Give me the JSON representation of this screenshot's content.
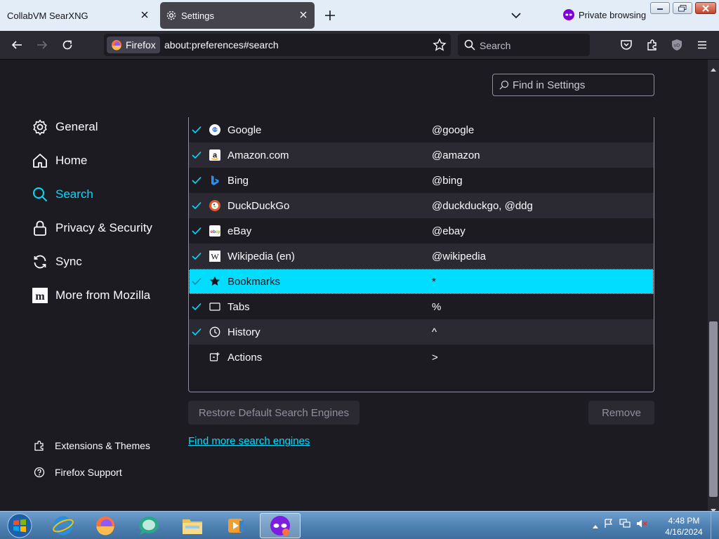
{
  "tabs": [
    {
      "title": "CollabVM SearXNG"
    },
    {
      "title": "Settings"
    }
  ],
  "private_label": "Private browsing",
  "urlbar": {
    "identity": "Firefox",
    "url": "about:preferences#search"
  },
  "searchbar": {
    "placeholder": "Search"
  },
  "find_settings_placeholder": "Find in Settings",
  "categories": [
    {
      "label": "General",
      "icon": "gear-icon"
    },
    {
      "label": "Home",
      "icon": "home-icon"
    },
    {
      "label": "Search",
      "icon": "search-icon",
      "selected": true
    },
    {
      "label": "Privacy & Security",
      "icon": "lock-icon"
    },
    {
      "label": "Sync",
      "icon": "sync-icon"
    },
    {
      "label": "More from Mozilla",
      "icon": "mozilla-icon"
    }
  ],
  "footer_links": [
    {
      "label": "Extensions & Themes",
      "icon": "puzzle-icon"
    },
    {
      "label": "Firefox Support",
      "icon": "help-icon"
    }
  ],
  "engines": [
    {
      "name": "Google",
      "keyword": "@google",
      "checked": true,
      "icon": "google-icon"
    },
    {
      "name": "Amazon.com",
      "keyword": "@amazon",
      "checked": true,
      "icon": "amazon-icon"
    },
    {
      "name": "Bing",
      "keyword": "@bing",
      "checked": true,
      "icon": "bing-icon"
    },
    {
      "name": "DuckDuckGo",
      "keyword": "@duckduckgo, @ddg",
      "checked": true,
      "icon": "duckduckgo-icon"
    },
    {
      "name": "eBay",
      "keyword": "@ebay",
      "checked": true,
      "icon": "ebay-icon"
    },
    {
      "name": "Wikipedia (en)",
      "keyword": "@wikipedia",
      "checked": true,
      "icon": "wikipedia-icon"
    },
    {
      "name": "Bookmarks",
      "keyword": "*",
      "checked": true,
      "icon": "star-icon",
      "selected": true
    },
    {
      "name": "Tabs",
      "keyword": "%",
      "checked": true,
      "icon": "tab-icon"
    },
    {
      "name": "History",
      "keyword": "^",
      "checked": true,
      "icon": "clock-icon"
    },
    {
      "name": "Actions",
      "keyword": ">",
      "checked": false,
      "icon": "actions-icon"
    }
  ],
  "buttons": {
    "restore": "Restore Default Search Engines",
    "remove": "Remove",
    "find_more": "Find more search engines"
  },
  "clock": {
    "time": "4:48 PM",
    "date": "4/16/2024"
  },
  "colors": {
    "accent": "#00ddff",
    "background": "#1c1b22",
    "toolbar": "#2b2a33"
  }
}
